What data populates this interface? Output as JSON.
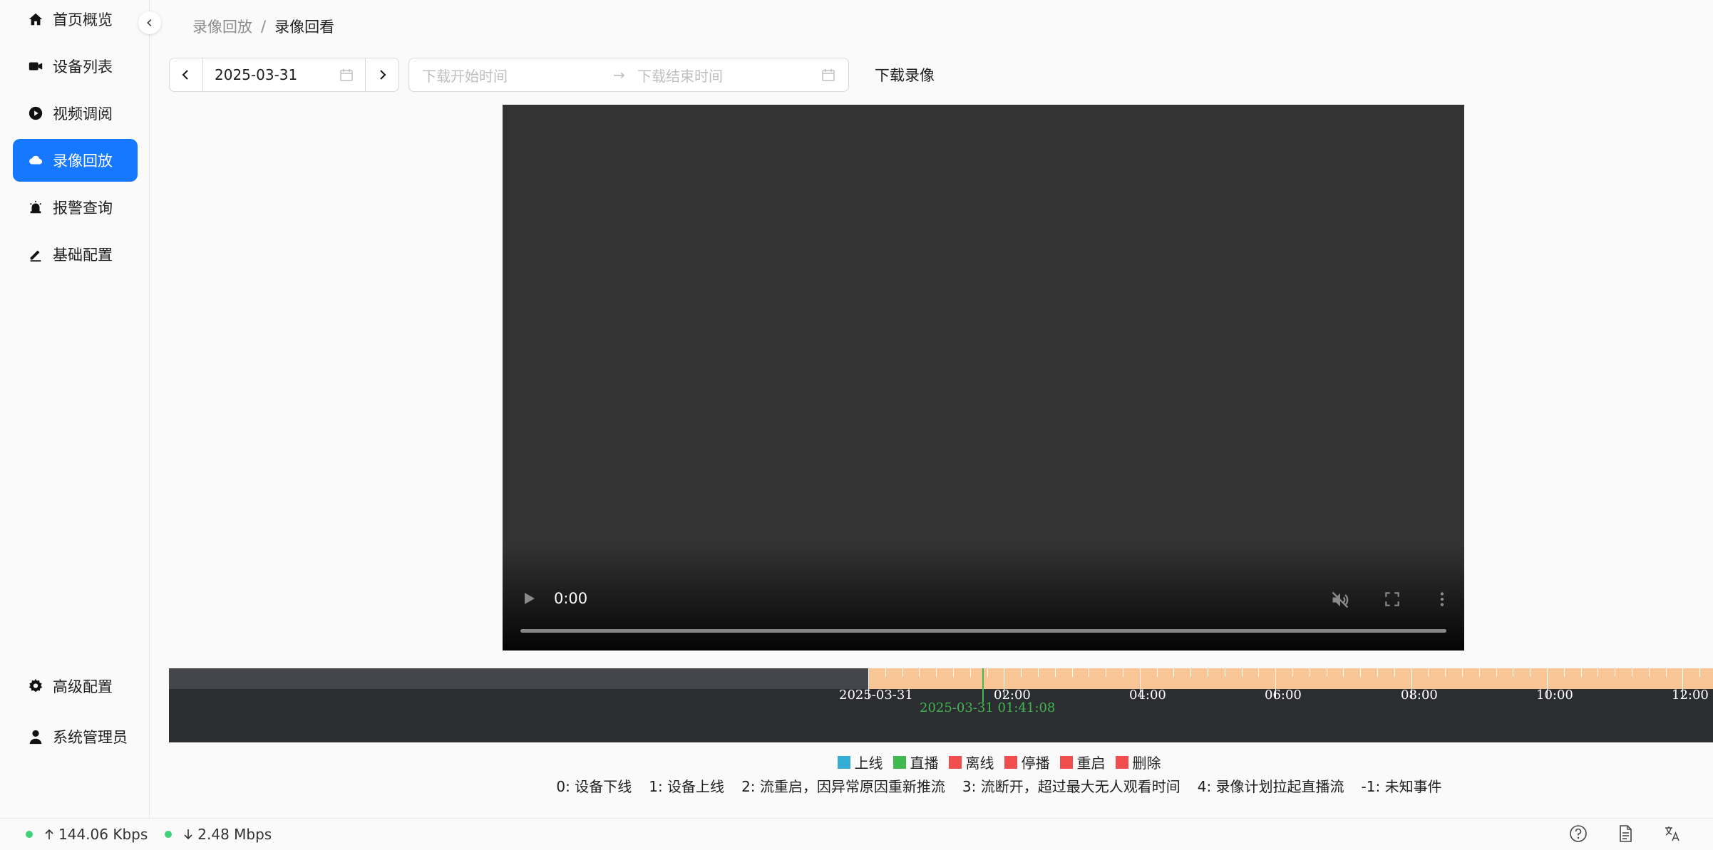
{
  "sidebar": {
    "top_items": [
      {
        "label": "首页概览",
        "icon": "home-icon"
      },
      {
        "label": "设备列表",
        "icon": "camera-icon"
      },
      {
        "label": "视频调阅",
        "icon": "play-circle-icon"
      },
      {
        "label": "录像回放",
        "icon": "cloud-icon",
        "active": true
      },
      {
        "label": "报警查询",
        "icon": "alarm-icon"
      },
      {
        "label": "基础配置",
        "icon": "edit-icon"
      }
    ],
    "bottom_items": [
      {
        "label": "高级配置",
        "icon": "gear-icon"
      },
      {
        "label": "系统管理员",
        "icon": "user-icon"
      }
    ]
  },
  "breadcrumb": {
    "parent": "录像回放",
    "separator": "/",
    "current": "录像回看"
  },
  "toolbar": {
    "date": "2025-03-31",
    "range_start_placeholder": "下载开始时间",
    "range_arrow": "→",
    "range_end_placeholder": "下载结束时间",
    "download_label": "下载录像"
  },
  "video": {
    "time": "0:00"
  },
  "timeline": {
    "labels": [
      "2025-03-31",
      "02:00",
      "04:00",
      "06:00",
      "08:00",
      "10:00",
      "12:00"
    ],
    "cursor_label": "2025-03-31 01:41:08",
    "colors": {
      "recorded": "#f8c694",
      "cursor": "#3fb950",
      "background": "#2c2d31"
    }
  },
  "legend": [
    {
      "label": "上线",
      "color": "#34aed6"
    },
    {
      "label": "直播",
      "color": "#3fb950"
    },
    {
      "label": "离线",
      "color": "#f04d4d"
    },
    {
      "label": "停播",
      "color": "#f04d4d"
    },
    {
      "label": "重启",
      "color": "#f04d4d"
    },
    {
      "label": "删除",
      "color": "#f04d4d"
    }
  ],
  "events": [
    "0: 设备下线",
    "1: 设备上线",
    "2: 流重启，因异常原因重新推流",
    "3: 流断开，超过最大无人观看时间",
    "4: 录像计划拉起直播流",
    "-1: 未知事件"
  ],
  "status": {
    "upload": "144.06 Kbps",
    "download": "2.48 Mbps",
    "dot_color": "#3fd07a",
    "icons": [
      "help-icon",
      "document-icon",
      "translate-icon"
    ]
  }
}
